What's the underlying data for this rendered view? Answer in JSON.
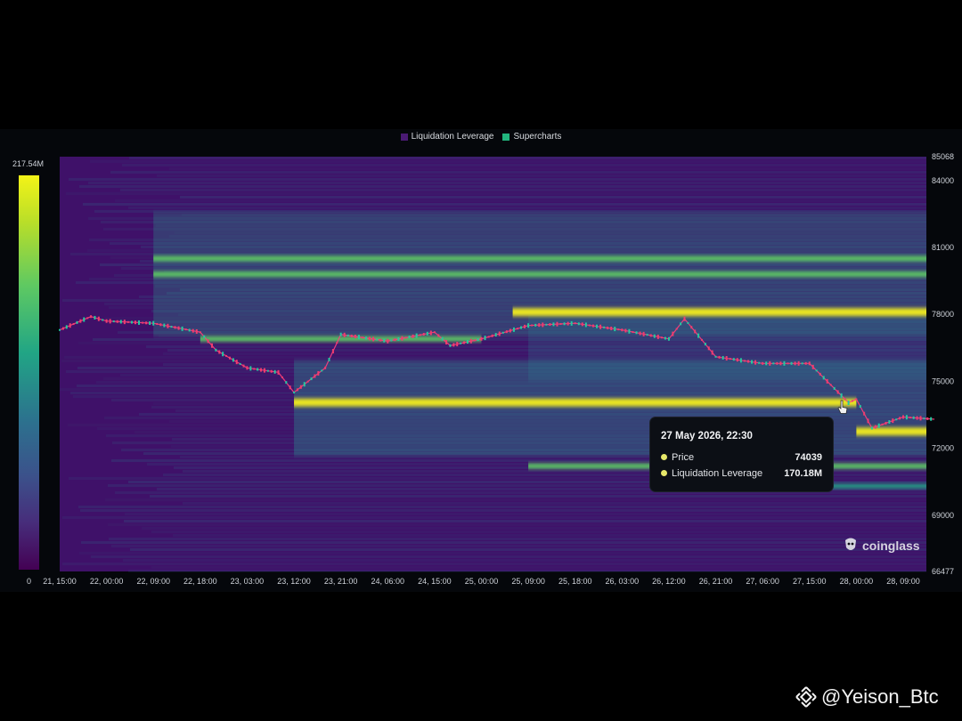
{
  "legend": [
    {
      "label": "Liquidation Leverage",
      "color": "#4a1a73"
    },
    {
      "label": "Supercharts",
      "color": "#22b57e"
    }
  ],
  "scale": {
    "max_label": "217.54M",
    "min_label": "0"
  },
  "tooltip": {
    "title": "27 May 2026, 22:30",
    "price_label": "Price",
    "price_value": "74039",
    "lev_label": "Liquidation Leverage",
    "lev_value": "170.18M"
  },
  "watermark": "coinglass",
  "credit": "@Yeison_Btc",
  "chart_data": {
    "type": "heatmap",
    "title": "",
    "ylim": [
      66477,
      85068
    ],
    "y_ticks": [
      85068,
      84000,
      81000,
      78000,
      75000,
      72000,
      69000,
      66477
    ],
    "x_ticks": [
      "21, 15:00",
      "22, 00:00",
      "22, 09:00",
      "22, 18:00",
      "23, 03:00",
      "23, 12:00",
      "23, 21:00",
      "24, 06:00",
      "24, 15:00",
      "25, 00:00",
      "25, 09:00",
      "25, 18:00",
      "26, 03:00",
      "26, 12:00",
      "26, 21:00",
      "27, 06:00",
      "27, 15:00",
      "28, 00:00",
      "28, 09:00"
    ],
    "colorbar": [
      0,
      "217.54M"
    ],
    "liquidation_bands": [
      {
        "price": 78100,
        "start": "25, 06:00",
        "end": "28, 15:00",
        "intensity": "high"
      },
      {
        "price": 74050,
        "start": "23, 12:00",
        "end": "28, 00:00",
        "intensity": "high"
      },
      {
        "price": 72750,
        "start": "28, 00:00",
        "end": "28, 15:00",
        "intensity": "high"
      },
      {
        "price": 79800,
        "start": "22, 09:00",
        "end": "28, 15:00",
        "intensity": "medium"
      },
      {
        "price": 80500,
        "start": "22, 09:00",
        "end": "28, 15:00",
        "intensity": "medium"
      },
      {
        "price": 76900,
        "start": "22, 18:00",
        "end": "25, 00:00",
        "intensity": "medium"
      },
      {
        "price": 71200,
        "start": "25, 09:00",
        "end": "28, 15:00",
        "intensity": "medium"
      },
      {
        "price": 70300,
        "start": "26, 12:00",
        "end": "28, 15:00",
        "intensity": "low"
      }
    ],
    "price_series": {
      "x": [
        "21, 15:00",
        "21, 21:00",
        "22, 00:00",
        "22, 09:00",
        "22, 18:00",
        "22, 21:00",
        "23, 03:00",
        "23, 09:00",
        "23, 12:00",
        "23, 18:00",
        "23, 21:00",
        "24, 06:00",
        "24, 15:00",
        "24, 18:00",
        "25, 00:00",
        "25, 09:00",
        "25, 18:00",
        "26, 03:00",
        "26, 12:00",
        "26, 15:00",
        "26, 21:00",
        "27, 06:00",
        "27, 15:00",
        "27, 22:30",
        "28, 00:00",
        "28, 03:00",
        "28, 09:00",
        "28, 15:00"
      ],
      "y": [
        77300,
        77900,
        77700,
        77600,
        77200,
        76400,
        75600,
        75400,
        74500,
        75600,
        77100,
        76800,
        77200,
        76600,
        76900,
        77500,
        77600,
        77300,
        76900,
        77800,
        76100,
        75800,
        75800,
        74039,
        74200,
        72900,
        73400,
        73300
      ]
    }
  }
}
